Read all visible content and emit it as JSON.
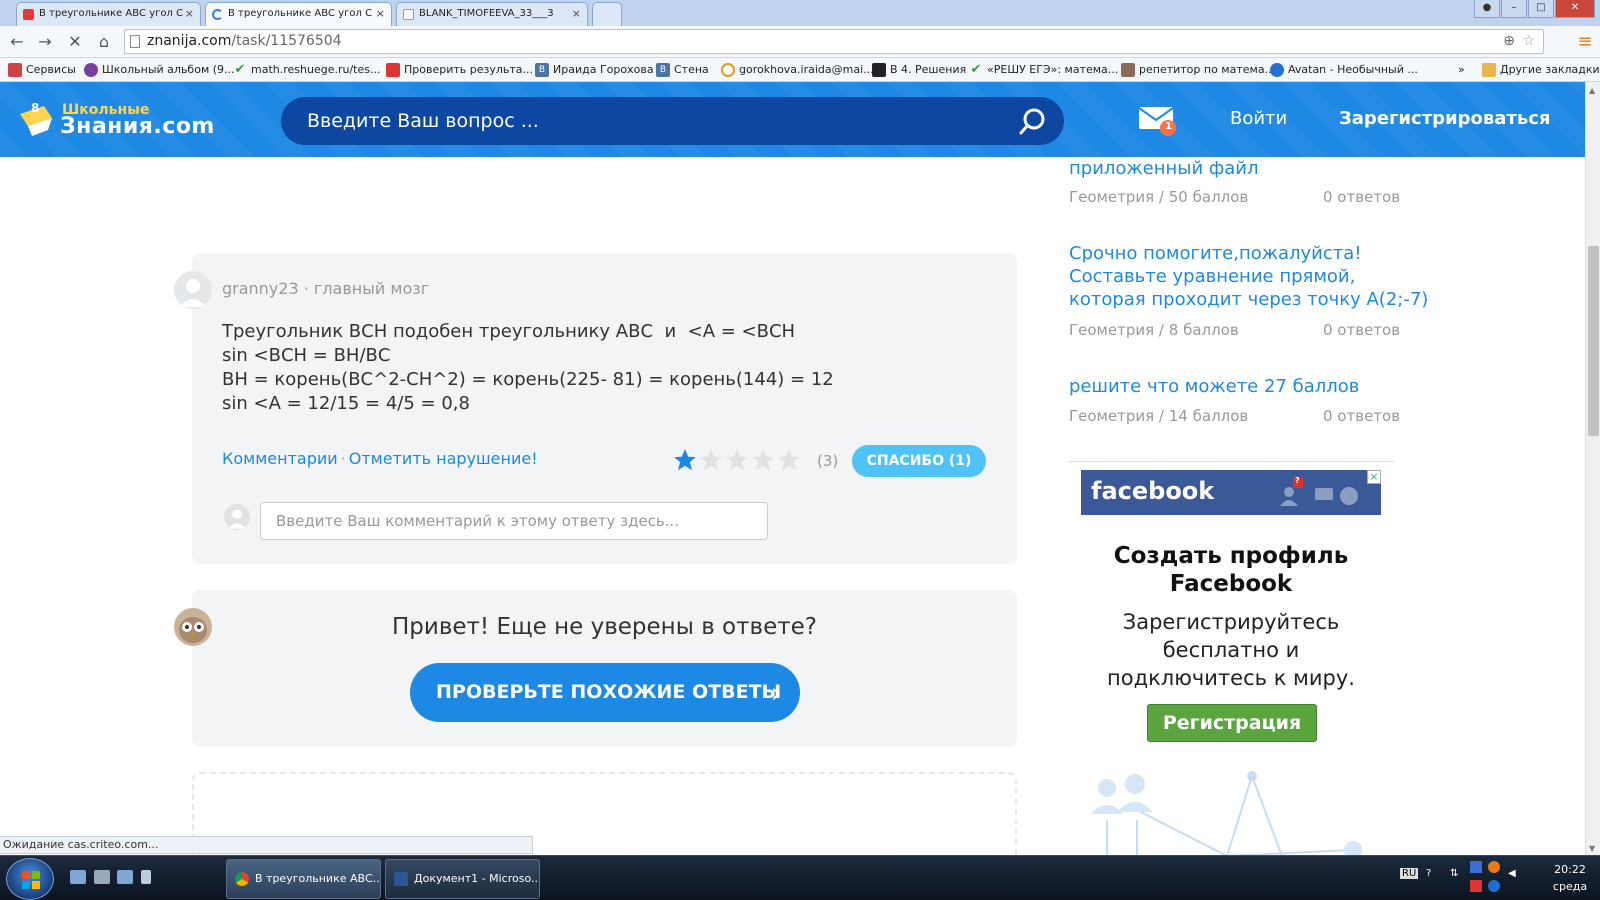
{
  "browser": {
    "tabs": [
      {
        "title": "В треугольнике АВС угол С",
        "close": "×"
      },
      {
        "title": "В треугольнике АВС угол С",
        "close": "×"
      },
      {
        "title": "BLANK_TIMOFEEVA_33___3",
        "close": "×"
      }
    ],
    "url_host": "znanija.com",
    "url_path": "/task/11576504",
    "bookmarks": [
      "Сервисы",
      "Школьный альбом (9...",
      "math.reshuege.ru/tes...",
      "Проверить результа...",
      "Ираида Горохова",
      "Стена",
      "gorokhova.iraida@mai...",
      "В 4. Решения",
      "«РЕШУ ЕГЭ»: матема...",
      "репетитор по матема...",
      "Avatan - Необычный ...",
      "»",
      "Другие закладки"
    ],
    "status_text": "Ожидание cas.criteo.com..."
  },
  "header": {
    "logo_small": "Школьные",
    "logo_big": "Знания.com",
    "search_placeholder": "Введите Ваш вопрос ...",
    "mail_badge": "1",
    "login": "Войти",
    "register": "Зарегистрироваться"
  },
  "answer": {
    "author": "granny23",
    "author_sep": " · ",
    "rank": "главный мозг",
    "lines": [
      "Треугольник ВСН подобен треугольнику АВС  и  <А = <ВСН",
      "sin <ВСН = ВН/ВС",
      "ВН = корень(ВС^2-СН^2) = корень(225- 81) = корень(144) = 12",
      "sin <A = 12/15 = 4/5 = 0,8"
    ],
    "comments_link": "Комментарии",
    "link_sep": "·",
    "report_link": "Отметить нарушение!",
    "rating_filled": 1,
    "rating_max": 5,
    "rating_count": "(3)",
    "thanks_button": "СПАСИБО (1)",
    "comment_placeholder": "Введите Ваш комментарий к этому ответу здесь..."
  },
  "prompt": {
    "title": "Привет! Еще не уверены в ответе?",
    "button": "ПРОВЕРЬТЕ ПОХОЖИЕ ОТВЕТЫ",
    "chevron": "›"
  },
  "sidebar": {
    "questions": [
      {
        "title_lines": [
          "приложенный файл"
        ],
        "subject": "Геометрия",
        "sep": "/",
        "points": "50 баллов",
        "answers": "0 ответов"
      },
      {
        "title_lines": [
          "Срочно помогите,пожалуйста!",
          "Составьте уравнение прямой,",
          "которая проходит через точку А(2;-7)"
        ],
        "subject": "Геометрия",
        "sep": "/",
        "points": "8 баллов",
        "answers": "0 ответов"
      },
      {
        "title_lines": [
          "решите что можете 27 баллов"
        ],
        "subject": "Геометрия",
        "sep": "/",
        "points": "14 баллов",
        "answers": "0 ответов"
      }
    ]
  },
  "ad": {
    "brand": "facebook",
    "notif_badge": "?",
    "close": "×",
    "title_lines": [
      "Создать профиль",
      "Facebook"
    ],
    "sub_lines": [
      "Зарегистрируйтесь",
      "бесплатно и",
      "подключитесь к миру."
    ],
    "button": "Регистрация"
  },
  "taskbar": {
    "tasks": [
      "В треугольнике АВС...",
      "Документ1 - Microso..."
    ],
    "lang": "RU",
    "time": "20:22",
    "day": "среда"
  },
  "colors": {
    "brand_blue": "#1e88e5",
    "link_blue": "#1e88e5",
    "thanks_blue": "#4fc3f7",
    "star_filled": "#1e88e5",
    "star_empty": "#e0e3e5",
    "fb_blue": "#3b5998",
    "fb_green": "#5ba53f"
  }
}
